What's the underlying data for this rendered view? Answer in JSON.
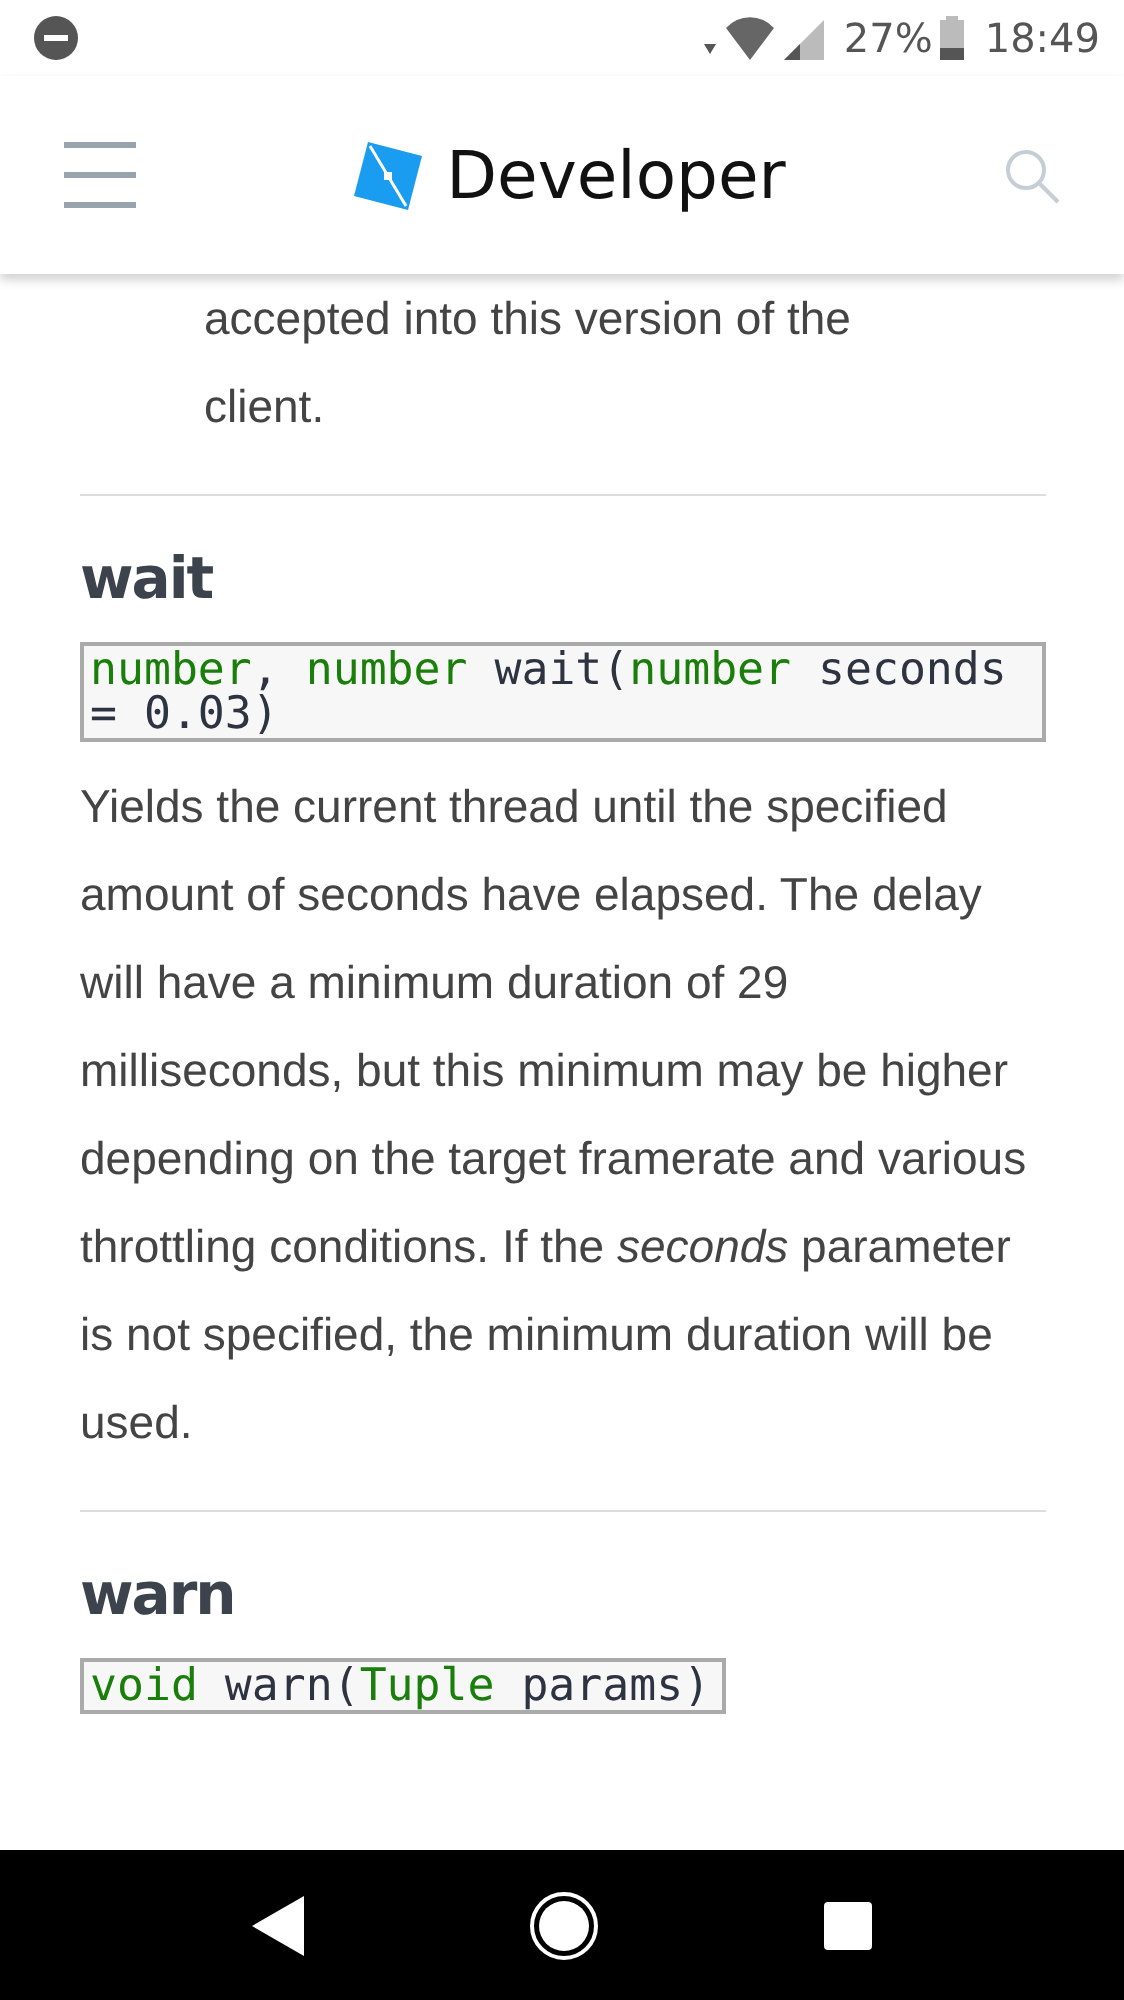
{
  "status_bar": {
    "battery": "27%",
    "time": "18:49"
  },
  "header": {
    "title": "Developer"
  },
  "intro_text": [
    "accepted into this version of the",
    "client."
  ],
  "entries": [
    {
      "name": "wait",
      "signature": [
        {
          "kind": "type",
          "text": "number"
        },
        {
          "kind": "plain",
          "text": ", "
        },
        {
          "kind": "type",
          "text": "number"
        },
        {
          "kind": "plain",
          "text": " wait("
        },
        {
          "kind": "type",
          "text": "number"
        },
        {
          "kind": "plain",
          "text": " seconds = 0.03)"
        }
      ],
      "description": "Yields the current thread until the specified amount of seconds have elapsed. The delay will have a minimum duration of 29 milliseconds, but this minimum may be higher depending on the target framerate and various throttling conditions. If the *seconds* parameter is not specified, the minimum duration will be used."
    },
    {
      "name": "warn",
      "signature": [
        {
          "kind": "type",
          "text": "void"
        },
        {
          "kind": "plain",
          "text": " warn("
        },
        {
          "kind": "type",
          "text": "Tuple"
        },
        {
          "kind": "plain",
          "text": " params)"
        }
      ]
    }
  ]
}
